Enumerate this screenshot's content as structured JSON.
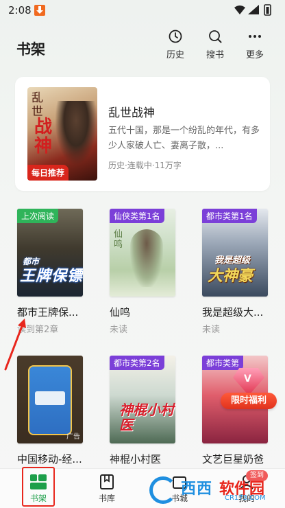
{
  "status_bar": {
    "time": "2:08"
  },
  "header": {
    "title": "书架",
    "actions": [
      {
        "label": "历史",
        "icon": "clock-icon"
      },
      {
        "label": "搜书",
        "icon": "search-icon"
      },
      {
        "label": "更多",
        "icon": "more-dots-icon"
      }
    ]
  },
  "featured": {
    "cover_title_top": "乱世",
    "cover_title_bottom": "战神",
    "badge": "每日推荐",
    "title": "乱世战神",
    "description": "五代十国，那是一个纷乱的年代，有多少人家破人亡、妻离子散，...",
    "meta": "历史·连载中·11万字"
  },
  "books": [
    {
      "title": "都市王牌保...",
      "status": "读到第2章",
      "tag": "上次阅读",
      "cover_big": "王牌保镖",
      "cover_small": "都市"
    },
    {
      "title": "仙鸣",
      "status": "未读",
      "tag": "仙侠类第1名",
      "cover_cal": "仙鸣"
    },
    {
      "title": "我是超级大...",
      "status": "未读",
      "tag": "都市类第1名",
      "cover_big": "大神豪",
      "cover_small": "我是超级"
    },
    {
      "title": "中国移动-经...",
      "status": "",
      "tag": "",
      "cover_ad": "广告"
    },
    {
      "title": "神棍小村医",
      "status": "",
      "tag": "都市类第2名",
      "cover_big": "神棍小村医"
    },
    {
      "title": "文艺巨星奶爸",
      "status": "",
      "tag": "都市类第",
      "cover_big": ""
    }
  ],
  "promo": {
    "label": "限时福利",
    "gem_letter": "V"
  },
  "bottom_nav": [
    {
      "label": "书架",
      "icon": "bookshelf-icon",
      "active": true
    },
    {
      "label": "书库",
      "icon": "book-icon",
      "active": false
    },
    {
      "label": "书城",
      "icon": "store-icon",
      "active": false
    },
    {
      "label": "我的",
      "icon": "profile-icon",
      "active": false,
      "badge": "签到"
    }
  ],
  "watermark": {
    "brand": "西西",
    "brand2": "软件园",
    "url": "CR173.COM"
  },
  "colors": {
    "accent_green": "#1d9f4a",
    "tag_purple": "#7b3fd8",
    "tag_green": "#2fb45a",
    "badge_red": "#d9261c",
    "annotation_red": "#e8261c"
  }
}
